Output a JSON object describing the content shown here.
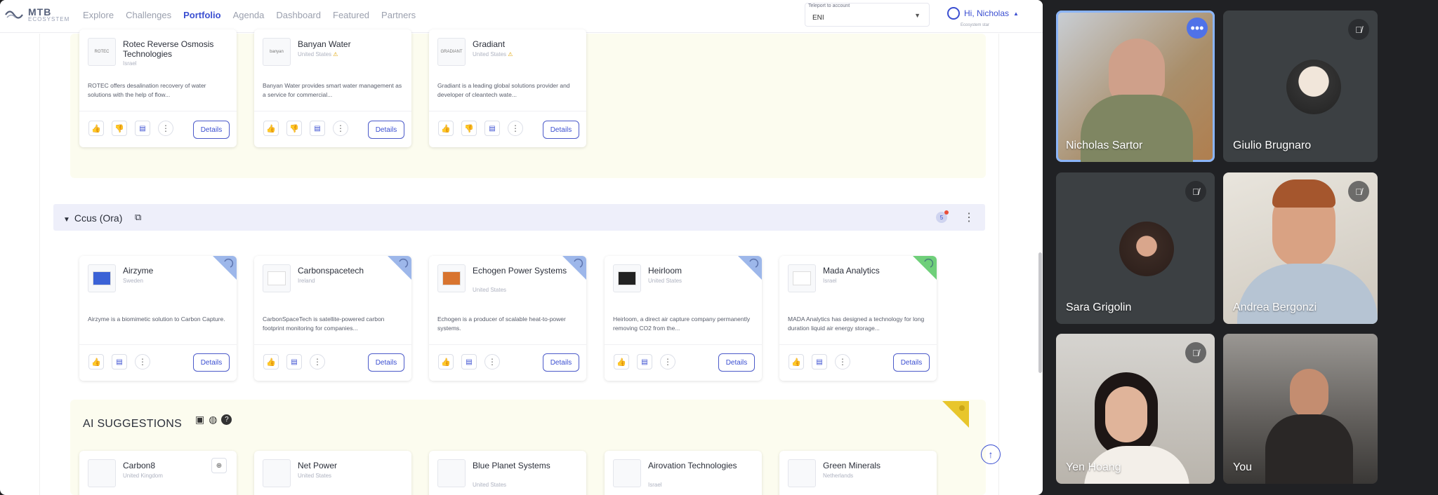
{
  "app": {
    "logo_main": "MTB",
    "logo_sub": "ECOSYSTEM",
    "nav": [
      "Explore",
      "Challenges",
      "Portfolio",
      "Agenda",
      "Dashboard",
      "Featured",
      "Partners"
    ],
    "active_nav": "Portfolio",
    "teleport": {
      "label": "Teleport to account",
      "value": "ENI"
    },
    "user": {
      "greeting": "Hi, Nicholas",
      "sub": "Ecosystem star"
    }
  },
  "top_cards": [
    {
      "name": "Rotec Reverse Osmosis Technologies",
      "country": "Israel",
      "logo": "ROTEC",
      "desc": "ROTEC offers desalination recovery of water solutions with the help of flow..."
    },
    {
      "name": "Banyan Water",
      "country": "United States",
      "logo": "banyan",
      "desc": "Banyan Water provides smart water management as a service for commercial..."
    },
    {
      "name": "Gradiant",
      "country": "United States",
      "logo": "GRADIANT",
      "desc": "Gradiant is a leading global solutions provider and developer of cleantech wate..."
    }
  ],
  "section": {
    "title": "Ccus (Ora)",
    "badge": "5"
  },
  "ccus_cards": [
    {
      "name": "Airzyme",
      "country": "Sweden",
      "desc": "Airzyme is a biomimetic solution to Carbon Capture.",
      "corner": "#9db7ea",
      "logo_color": "#3b62d6"
    },
    {
      "name": "Carbonspacetech",
      "country": "Ireland",
      "desc": "CarbonSpaceTech is satellite-powered carbon footprint monitoring for companies...",
      "corner": "#9db7ea",
      "logo_color": "#ffffff"
    },
    {
      "name": "Echogen Power Systems",
      "country": "United States",
      "desc": "Echogen is a producer of scalable heat-to-power systems.",
      "corner": "#9db7ea",
      "logo_color": "#d8742f"
    },
    {
      "name": "Heirloom",
      "country": "United States",
      "desc": "Heirloom, a direct air capture company permanently removing CO2 from the...",
      "corner": "#9db7ea",
      "logo_color": "#222222"
    },
    {
      "name": "Mada Analytics",
      "country": "Israel",
      "desc": "MADA Analytics has designed a technology for long duration liquid air energy storage...",
      "corner": "#6fcf7a",
      "logo_color": "#ffffff"
    }
  ],
  "details_label": "Details",
  "ai": {
    "title": "AI SUGGESTIONS",
    "cards": [
      {
        "name": "Carbon8",
        "country": "United Kingdom"
      },
      {
        "name": "Net Power",
        "country": "United States"
      },
      {
        "name": "Blue Planet Systems",
        "country": "United States"
      },
      {
        "name": "Airovation Technologies",
        "country": "Israel"
      },
      {
        "name": "Green Minerals",
        "country": "Netherlands"
      }
    ]
  },
  "meet": {
    "participants": [
      {
        "name": "Nicholas Sartor",
        "speaking": true
      },
      {
        "name": "Giulio Brugnaro",
        "muted": true
      },
      {
        "name": "Sara Grigolin",
        "muted": true
      },
      {
        "name": "Andrea Bergonzi",
        "muted": true
      },
      {
        "name": "Yen Hoang",
        "muted": true
      },
      {
        "name": "You"
      }
    ]
  }
}
